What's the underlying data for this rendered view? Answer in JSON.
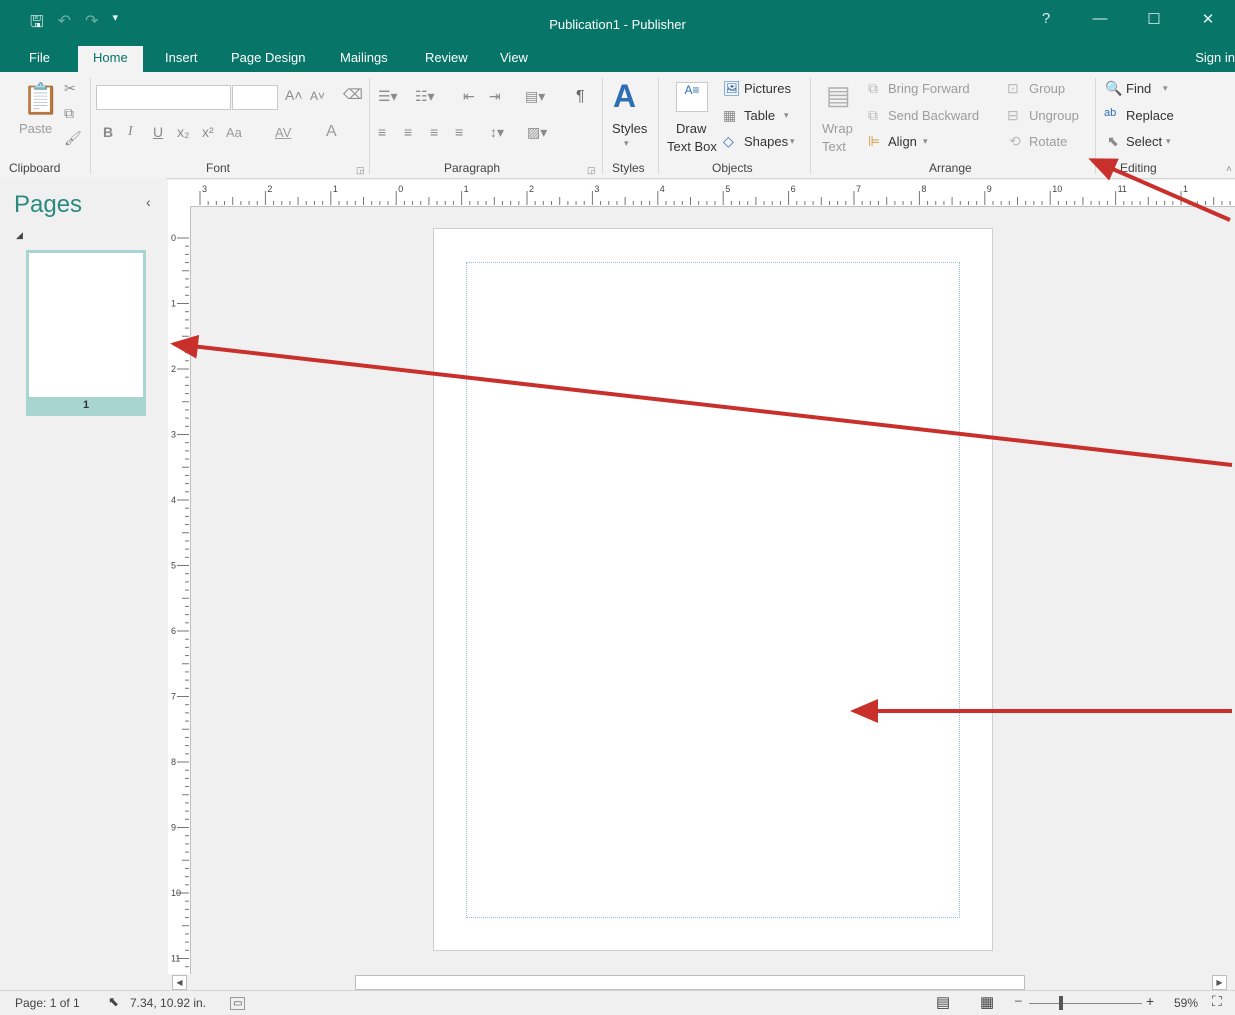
{
  "window": {
    "title": "Publication1 - Publisher",
    "help": "?",
    "minimize": "—",
    "maximize": "☐",
    "close": "✕"
  },
  "tabs": [
    "File",
    "Home",
    "Insert",
    "Page Design",
    "Mailings",
    "Review",
    "View"
  ],
  "active_tab": "Home",
  "signin": "Sign in",
  "ribbon": {
    "clipboard": {
      "label": "Clipboard",
      "paste": "Paste"
    },
    "font": {
      "label": "Font",
      "font_name": "",
      "font_size": "",
      "case": "Aa",
      "spacing": "AV",
      "color": "A"
    },
    "paragraph": {
      "label": "Paragraph",
      "pilcrow": "¶"
    },
    "styles": {
      "label": "Styles",
      "styles_btn": "Styles"
    },
    "objects": {
      "label": "Objects",
      "draw_text_box_1": "Draw",
      "draw_text_box_2": "Text Box",
      "pictures": "Pictures",
      "table": "Table",
      "shapes": "Shapes"
    },
    "arrange": {
      "label": "Arrange",
      "wrap_text_1": "Wrap",
      "wrap_text_2": "Text",
      "bring_forward": "Bring Forward",
      "send_backward": "Send Backward",
      "align": "Align",
      "group": "Group",
      "ungroup": "Ungroup",
      "rotate": "Rotate"
    },
    "editing": {
      "label": "Editing",
      "find": "Find",
      "replace": "Replace",
      "select": "Select"
    }
  },
  "pages_pane": {
    "title": "Pages",
    "collapse": "‹",
    "pages": [
      {
        "number": "1"
      }
    ]
  },
  "ruler": {
    "h_labels": [
      "3",
      "2",
      "1",
      "0",
      "1",
      "2",
      "3",
      "4",
      "5",
      "6",
      "7",
      "8",
      "9",
      "10",
      "11",
      "1"
    ],
    "v_labels": [
      "0",
      "1",
      "2",
      "3",
      "4",
      "5",
      "6",
      "7",
      "8",
      "9",
      "10",
      "11"
    ]
  },
  "status": {
    "page": "Page: 1 of 1",
    "position": "7.34, 10.92 in.",
    "zoom": "59%",
    "zoom_minus": "–",
    "zoom_plus": "+"
  },
  "colors": {
    "title_bar": "#077568",
    "accent": "#2a8a7d",
    "annotation_arrow": "#c9302c"
  }
}
